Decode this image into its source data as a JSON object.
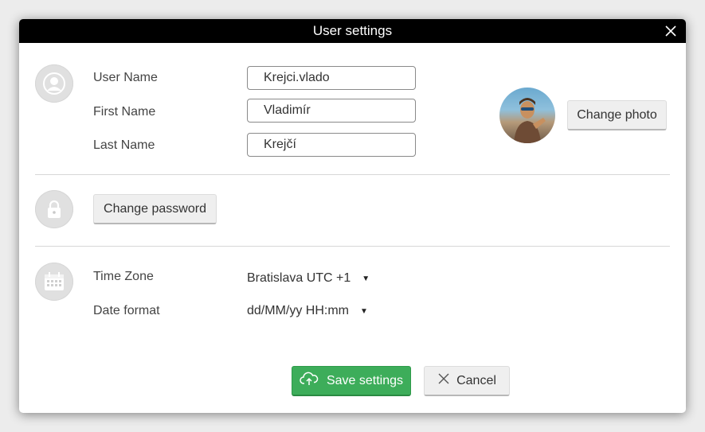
{
  "dialog": {
    "title": "User settings",
    "close_icon": "close-icon"
  },
  "profile": {
    "icon": "user-icon",
    "user_name_label": "User Name",
    "user_name_value": "Krejci.vlado",
    "first_name_label": "First Name",
    "first_name_value": "Vladimír",
    "last_name_label": "Last Name",
    "last_name_value": "Krejčí",
    "change_photo_label": "Change photo"
  },
  "security": {
    "icon": "lock-icon",
    "change_password_label": "Change password"
  },
  "locale": {
    "icon": "calendar-icon",
    "time_zone_label": "Time Zone",
    "time_zone_value": "Bratislava UTC +1",
    "date_format_label": "Date format",
    "date_format_value": "dd/MM/yy HH:mm"
  },
  "footer": {
    "save_label": "Save settings",
    "save_icon": "cloud-upload-icon",
    "cancel_label": "Cancel",
    "cancel_icon": "close-icon"
  },
  "colors": {
    "titlebar": "#000000",
    "save_button": "#3dad5a",
    "icon_circle": "#e0e0e0"
  }
}
